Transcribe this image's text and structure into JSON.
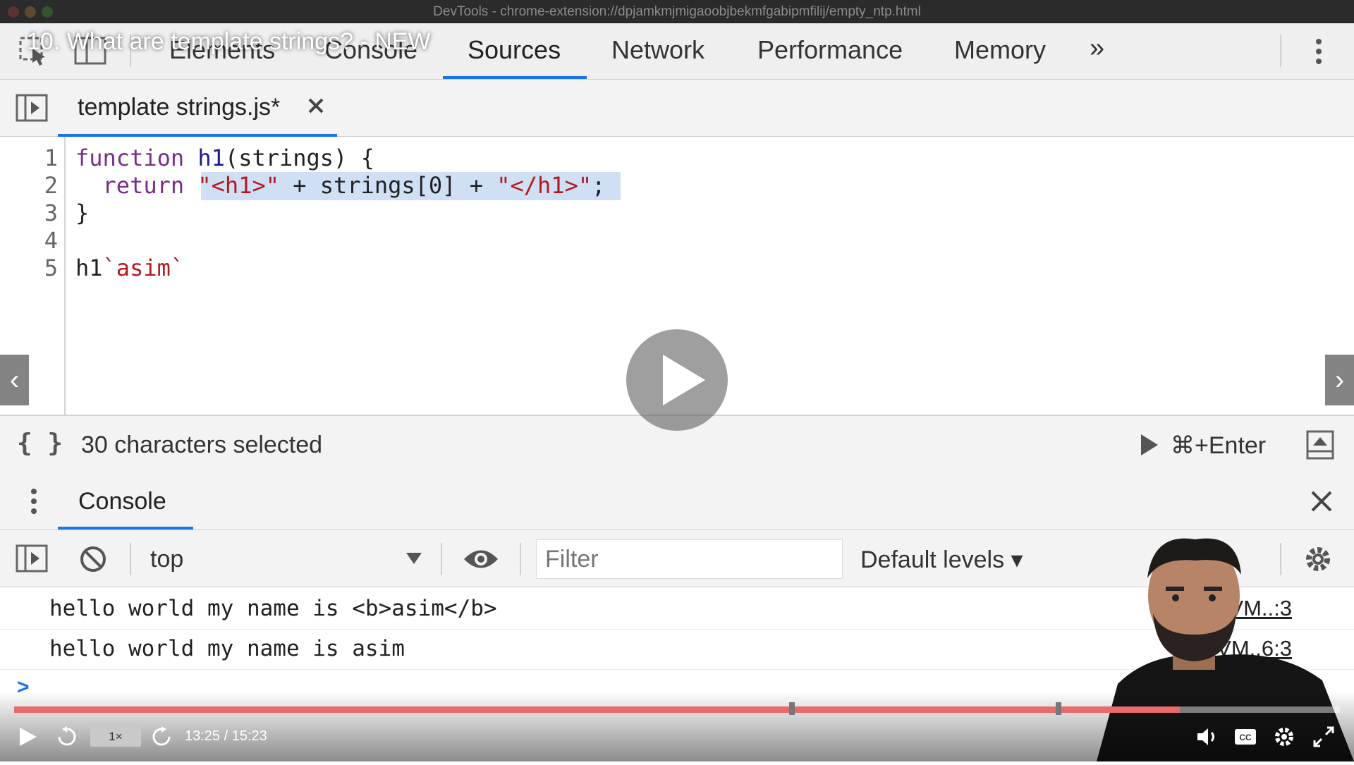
{
  "window": {
    "title": "DevTools - chrome-extension://dpjamkmjmigaoobjbekmfgabipmfilij/empty_ntp.html"
  },
  "video": {
    "title": "10. What are template strings? - NEW",
    "time": "13:25 / 15:23",
    "speed": "1×",
    "progress_fraction": 0.879
  },
  "devtools": {
    "tabs": [
      "Elements",
      "Console",
      "Sources",
      "Network",
      "Performance",
      "Memory"
    ],
    "active_tab": "Sources",
    "more_tabs_label": "»",
    "file_tab": "template strings.js*",
    "code_lines": [
      "1",
      "2",
      "3",
      "4",
      "5"
    ],
    "status": {
      "braces": "{ }",
      "selection": "30 characters selected",
      "run_shortcut": "⌘+Enter"
    },
    "drawer": {
      "tab": "Console",
      "context": "top",
      "filter_placeholder": "Filter",
      "levels": "Default levels ▾",
      "prompt": ">",
      "logs": [
        {
          "text": "hello world my name is <b>asim</b>",
          "source": "VM..:3"
        },
        {
          "text": "hello world my name is asim",
          "source": "VM..6:3"
        }
      ]
    }
  },
  "colors": {
    "accent": "#1a73e8",
    "progress": "#e86a6a",
    "keyword": "#7a2d8a",
    "string": "#b5171f",
    "selection": "#cfe0f5"
  }
}
